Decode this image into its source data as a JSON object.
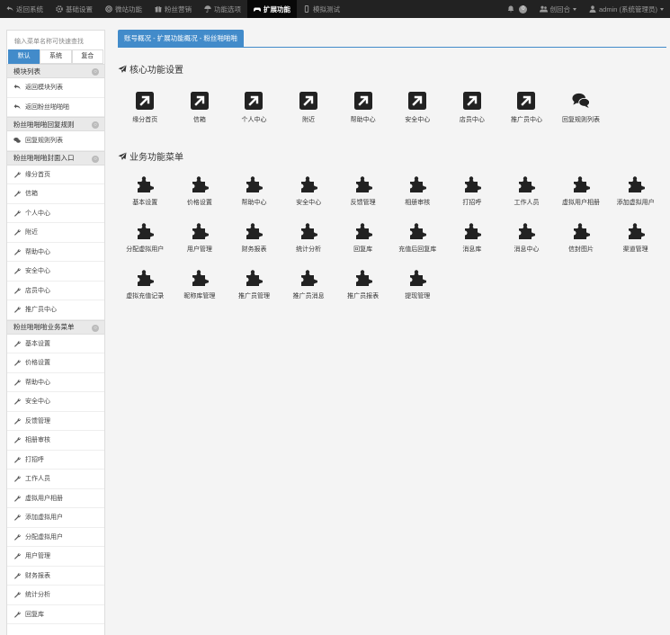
{
  "topnav": {
    "items": [
      {
        "label": "返回系统",
        "icon": "undo-icon"
      },
      {
        "label": "基础设置",
        "icon": "gear-icon"
      },
      {
        "label": "微站功能",
        "icon": "lifebuoy-icon"
      },
      {
        "label": "粉丝营销",
        "icon": "gift-icon"
      },
      {
        "label": "功能选项",
        "icon": "umbrella-icon"
      },
      {
        "label": "扩展功能",
        "icon": "gamepad-icon",
        "active": true
      },
      {
        "label": "模拟测试",
        "icon": "mobile-icon"
      }
    ],
    "notifications_count": "0",
    "group_label": "创回合",
    "user_label": "admin (系统管理员)"
  },
  "sidebar": {
    "search_placeholder": "输入菜单名称可快速查找",
    "tabs": [
      "默认",
      "系统",
      "复合"
    ],
    "groups": [
      {
        "title": "模块列表",
        "items": [
          "返回模块列表",
          "返回粉丝啪啪啪"
        ]
      },
      {
        "title": "粉丝啪啪啪回复规则",
        "items": [
          "回复规则列表"
        ]
      },
      {
        "title": "粉丝啪啪啪封面入口",
        "items": [
          "缘分首页",
          "信箱",
          "个人中心",
          "附近",
          "帮助中心",
          "安全中心",
          "店员中心",
          "推广员中心"
        ]
      },
      {
        "title": "粉丝啪啪啪业务菜单",
        "items": [
          "基本设置",
          "价格设置",
          "帮助中心",
          "安全中心",
          "反馈管理",
          "相册审核",
          "打招呼",
          "工作人员",
          "虚拟用户相册",
          "添加虚拟用户",
          "分配虚拟用户",
          "用户管理",
          "财务报表",
          "统计分析",
          "回复库"
        ]
      }
    ]
  },
  "breadcrumb": "账号概况 - 扩展功能概况 - 粉丝啪啪啪",
  "core_section": {
    "title": "核心功能设置",
    "items": [
      "缘分首页",
      "信箱",
      "个人中心",
      "附近",
      "帮助中心",
      "安全中心",
      "店员中心",
      "推广员中心",
      "回复规则列表"
    ]
  },
  "business_section": {
    "title": "业务功能菜单",
    "items": [
      "基本设置",
      "价格设置",
      "帮助中心",
      "安全中心",
      "反馈管理",
      "相册审核",
      "打招呼",
      "工作人员",
      "虚拟用户相册",
      "添加虚拟用户",
      "分配虚拟用户",
      "用户管理",
      "财务报表",
      "统计分析",
      "回复库",
      "充值后回复库",
      "消息库",
      "消息中心",
      "信封图片",
      "渠道管理",
      "虚拟充值记录",
      "昵称库管理",
      "推广员管理",
      "推广员消息",
      "推广员报表",
      "提现管理"
    ]
  },
  "colors": {
    "navbar": "#222222",
    "accent": "#428bca",
    "icon": "#222222"
  }
}
